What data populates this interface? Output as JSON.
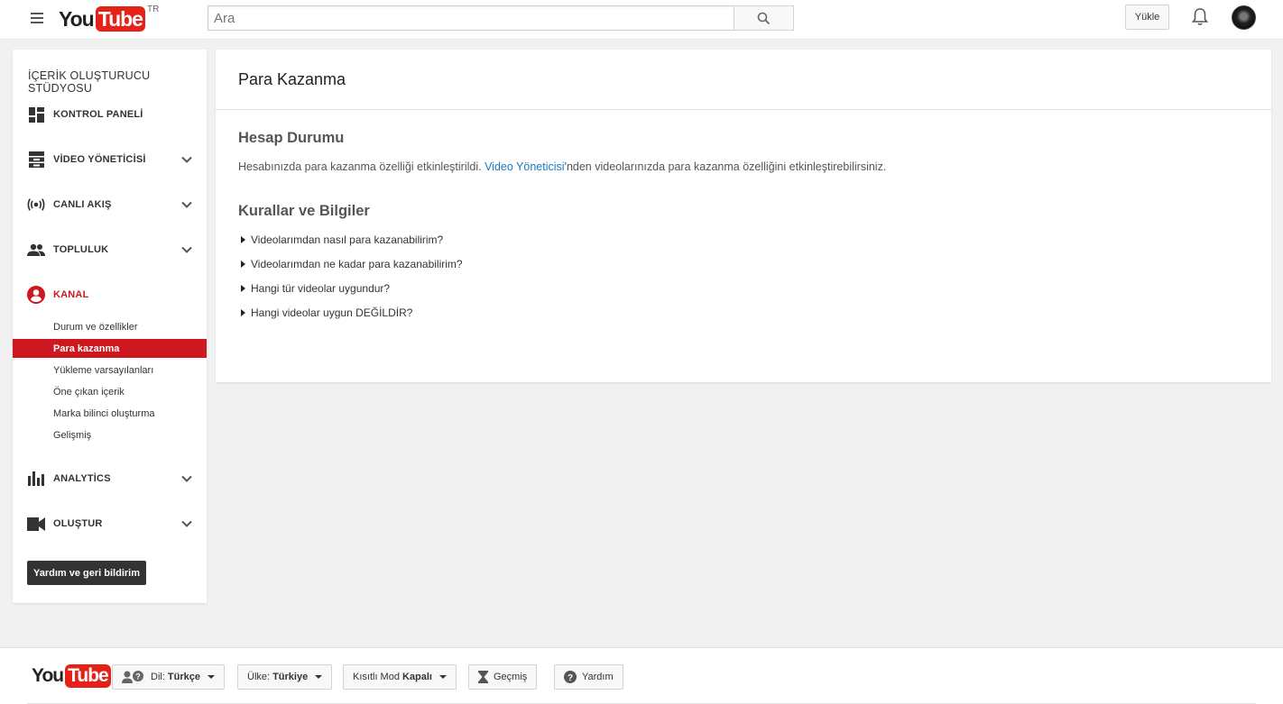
{
  "header": {
    "logo_you": "You",
    "logo_tube": "Tube",
    "country_code": "TR",
    "search_placeholder": "Ara",
    "upload_label": "Yükle"
  },
  "sidebar": {
    "title": "İÇERİK OLUŞTURUCU STÜDYOSU",
    "items": [
      {
        "label": "KONTROL PANELİ",
        "icon": "dashboard-icon"
      },
      {
        "label": "VİDEO YÖNETİCİSİ",
        "icon": "video-manager-icon"
      },
      {
        "label": "CANLI AKIŞ",
        "icon": "live-icon"
      },
      {
        "label": "TOPLULUK",
        "icon": "community-icon"
      },
      {
        "label": "KANAL",
        "icon": "channel-icon"
      },
      {
        "label": "ANALYTİCS",
        "icon": "analytics-icon"
      },
      {
        "label": "OLUŞTUR",
        "icon": "create-icon"
      }
    ],
    "channel_subitems": [
      "Durum ve özellikler",
      "Para kazanma",
      "Yükleme varsayılanları",
      "Öne çıkan içerik",
      "Marka bilinci oluşturma",
      "Gelişmiş"
    ],
    "help_button": "Yardım ve geri bildirim"
  },
  "main": {
    "title": "Para Kazanma",
    "account_status_heading": "Hesap Durumu",
    "status_before": "Hesabınızda para kazanma özelliği etkinleştirildi. ",
    "status_link": "Video Yöneticisi",
    "status_after": "'nden videolarınızda para kazanma özelliğini etkinleştirebilirsiniz.",
    "rules_heading": "Kurallar ve Bilgiler",
    "faq": [
      "Videolarımdan nasıl para kazanabilirim?",
      "Videolarımdan ne kadar para kazanabilirim?",
      "Hangi tür videolar uygundur?",
      "Hangi videolar uygun DEĞİLDİR?"
    ]
  },
  "footer": {
    "language_label": "Dil:",
    "language_value": "Türkçe",
    "country_label": "Ülke:",
    "country_value": "Türkiye",
    "restricted_label": "Kısıtlı Mod",
    "restricted_value": "Kapalı",
    "history_label": "Geçmiş",
    "help_label": "Yardım"
  },
  "colors": {
    "accent": "#cc181e",
    "link": "#167ac6"
  }
}
